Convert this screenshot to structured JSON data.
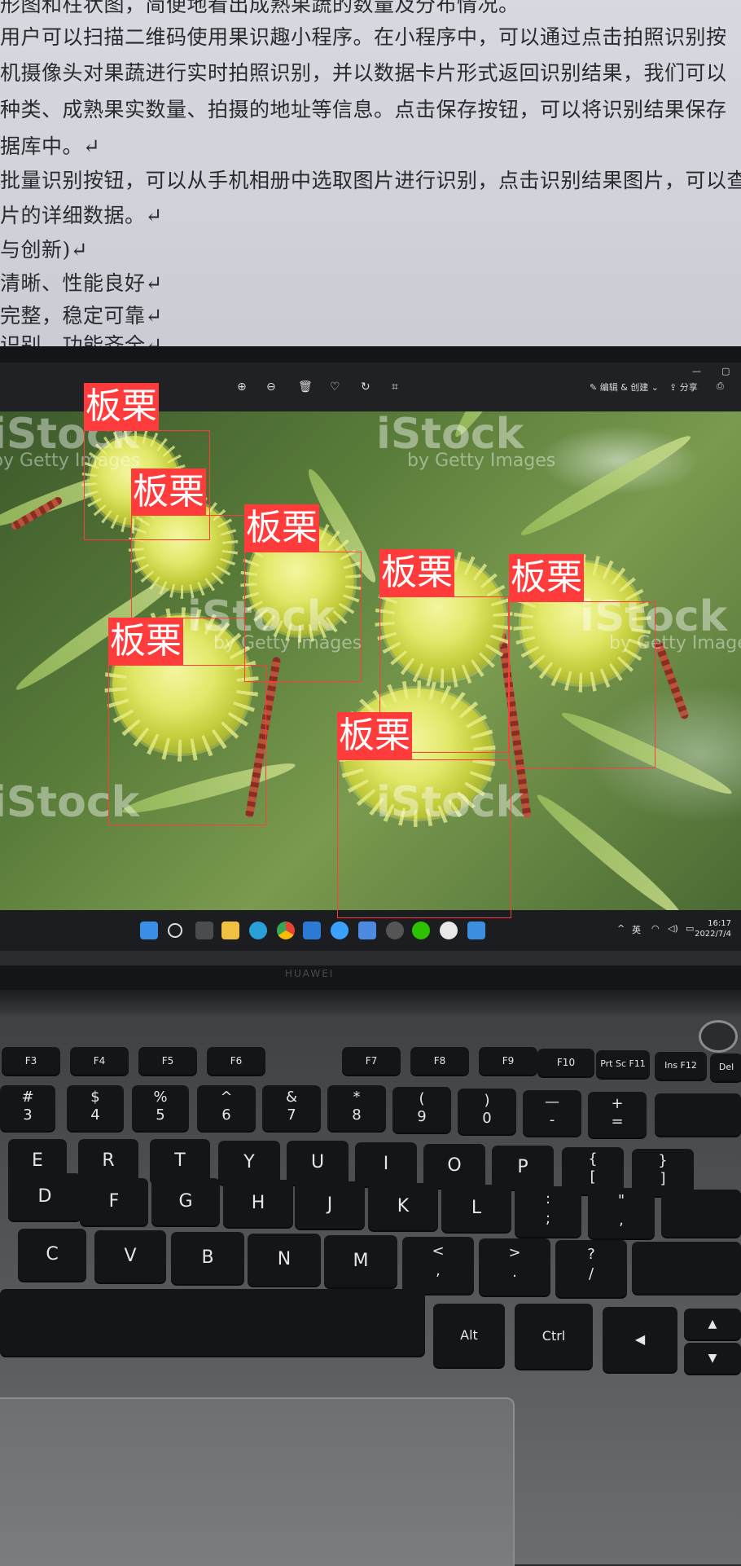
{
  "document": {
    "lines": [
      "形图和柱状图，简便地看出成熟果蔬的数量及分布情况。",
      "用户可以扫描二维码使用果识趣小程序。在小程序中，可以通过点击拍照识别按",
      "机摄像头对果蔬进行实时拍照识别，并以数据卡片形式返回识别结果，我们可以",
      "种类、成熟果实数量、拍摄的地址等信息。点击保存按钮，可以将识别结果保存",
      "据库中。↵",
      "批量识别按钮，可以从手机相册中选取图片进行识别，点击识别结果图片，可以查",
      "片的详细数据。↵",
      "与创新)↵",
      "清晰、性能良好↵",
      "完整，稳定可靠↵",
      "识别、功能齐全↵"
    ]
  },
  "viewer": {
    "window_controls": [
      "—",
      "▢"
    ],
    "toolbar_icons": [
      "zoom-in-icon",
      "zoom-out-icon",
      "delete-icon",
      "favorite-icon",
      "rotate-icon",
      "crop-icon"
    ],
    "edit_label": "编辑 & 创建",
    "share_label": "分享",
    "watermark_brand": "iStock",
    "watermark_sub": "by Getty Images"
  },
  "detections": [
    {
      "label": "板栗"
    },
    {
      "label": "板栗"
    },
    {
      "label": "板栗"
    },
    {
      "label": "板栗"
    },
    {
      "label": "板栗"
    },
    {
      "label": "板栗"
    },
    {
      "label": "板栗"
    }
  ],
  "taskbar": {
    "ime": "英",
    "time": "16:17",
    "date": "2022/7/4"
  },
  "laptop": {
    "brand": "HUAWEI",
    "keys": {
      "row_fn": [
        "F3",
        "F4",
        "F5",
        "F6",
        "F7",
        "F8",
        "F9",
        "F10",
        "Prt Sc F11",
        "Ins F12",
        "Del"
      ],
      "row_num": [
        "#\n3",
        "$\n4",
        "%\n5",
        "^\n6",
        "&\n7",
        "*\n8",
        "(\n9",
        ")\n0",
        "—\n-",
        "+\n="
      ],
      "row_q": [
        "E",
        "R",
        "T",
        "Y",
        "U",
        "I",
        "O",
        "P",
        "{\n[",
        "}\n]"
      ],
      "row_a": [
        "D",
        "F",
        "G",
        "H",
        "J",
        "K",
        "L",
        ":\n;",
        "\"\n,"
      ],
      "row_z": [
        "C",
        "V",
        "B",
        "N",
        "M",
        "<\n,",
        ">\n.",
        "?\n/"
      ],
      "row_bottom": [
        "Alt",
        "Ctrl",
        "◀",
        "▲",
        "▼"
      ]
    }
  },
  "colors": {
    "detection": "#ff3b3b",
    "burr": "#e2e86a"
  }
}
